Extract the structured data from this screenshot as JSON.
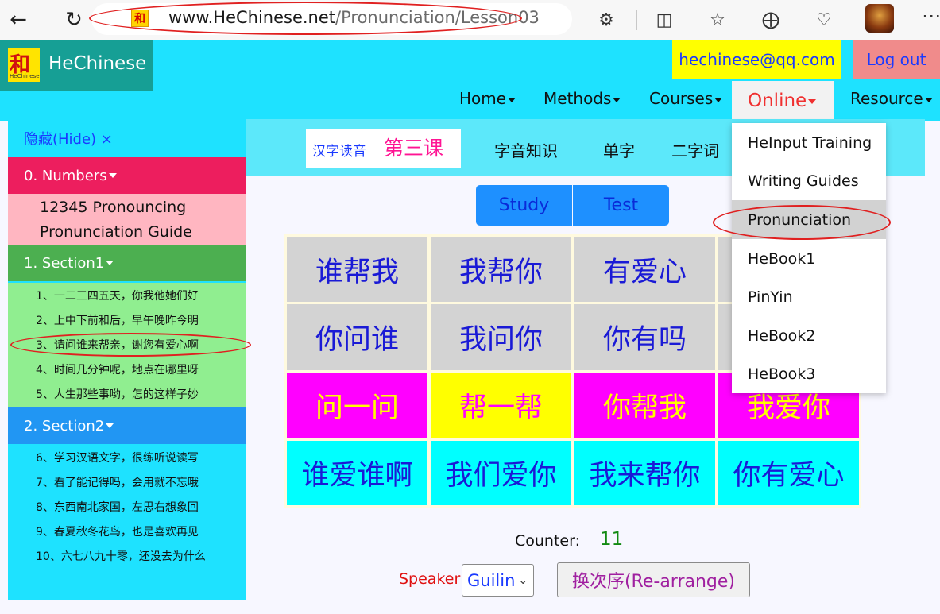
{
  "browser": {
    "url_host": "www.HeChinese.net",
    "url_path": "/Pronunciation/Lesson03",
    "favicon_glyph": "和",
    "icons": [
      "back-arrow-icon",
      "refresh-icon",
      "extensions-icon",
      "split-screen-icon",
      "favorites-icon",
      "collections-icon",
      "browser-essentials-icon",
      "profile-avatar-icon",
      "more-icon"
    ]
  },
  "header": {
    "brand_glyph": "和",
    "brand_tiny": "HeChinese",
    "brand_name": "HeChinese",
    "email": "hechinese@qq.com",
    "logout": "Log out",
    "menu": {
      "home": "Home",
      "methods": "Methods",
      "courses": "Courses",
      "online": "Online",
      "resource": "Resource"
    }
  },
  "dropdown": {
    "items": [
      "HeInput Training",
      "Writing Guides",
      "Pronunciation",
      "HeBook1",
      "PinYin",
      "HeBook2",
      "HeBook3"
    ],
    "active": "Pronunciation"
  },
  "sidebar": {
    "hide": "隐藏(Hide) ×",
    "section0": "0. Numbers",
    "section0_lines": [
      "12345 Pronouncing",
      "Pronunciation Guide"
    ],
    "section1": "1. Section1",
    "section1_items": [
      "1、一二三四五天，你我他她们好",
      "2、上中下前和后，早午晚昨今明",
      "3、请问谁来帮亲，谢您有爱心啊",
      "4、时间几分钟呢，地点在哪里呀",
      "5、人生那些事哟，怎的这样子妙"
    ],
    "section2": "2. Section2",
    "section2_items": [
      "6、学习汉语文字，很练听说读写",
      "7、看了能记得吗，会用就不忘哦",
      "8、东西南北家国，左思右想象回",
      "9、春夏秋冬花鸟，也是喜欢再见",
      "10、六七八九十零，还没去为什么"
    ],
    "colors": {
      "section0": "#ed1e5e",
      "section1": "#4caf50",
      "section2": "#2196f3"
    }
  },
  "lesson": {
    "title_small": "汉字读音",
    "title_big": "第三课",
    "tabs": [
      "字音知识",
      "单字",
      "二字词"
    ],
    "study": "Study",
    "test": "Test"
  },
  "grid": {
    "rows": [
      [
        "谁帮我",
        "我帮你",
        "有爱心",
        ""
      ],
      [
        "你问谁",
        "我问你",
        "你有吗",
        ""
      ],
      [
        "问一问",
        "帮一帮",
        "你帮我",
        "我爱你"
      ],
      [
        "谁爱谁啊",
        "我们爱你",
        "我来帮你",
        "你有爱心"
      ]
    ],
    "row_bg": [
      [
        "#d3d3d3",
        "#d3d3d3",
        "#d3d3d3",
        "#d3d3d3"
      ],
      [
        "#d3d3d3",
        "#d3d3d3",
        "#d3d3d3",
        "#d3d3d3"
      ],
      [
        "#ff00ff",
        "#ffff00",
        "#ff00ff",
        "#ff00ff"
      ],
      [
        "#00ffff",
        "#00ffff",
        "#00ffff",
        "#00ffff"
      ]
    ],
    "row_fg": [
      [
        "#1a1ad6",
        "#1a1ad6",
        "#1a1ad6",
        "#1a1ad6"
      ],
      [
        "#1a1ad6",
        "#1a1ad6",
        "#1a1ad6",
        "#1a1ad6"
      ],
      [
        "#ffff00",
        "#ff00ff",
        "#ffff00",
        "#ffff00"
      ],
      [
        "#1a1ad6",
        "#1a1ad6",
        "#1a1ad6",
        "#1a1ad6"
      ]
    ]
  },
  "controls": {
    "counter_label": "Counter:",
    "counter_value": "11",
    "speaker_label": "Speaker:",
    "speaker_value": "Guilin",
    "rearrange": "换次序(Re-arrange)"
  }
}
